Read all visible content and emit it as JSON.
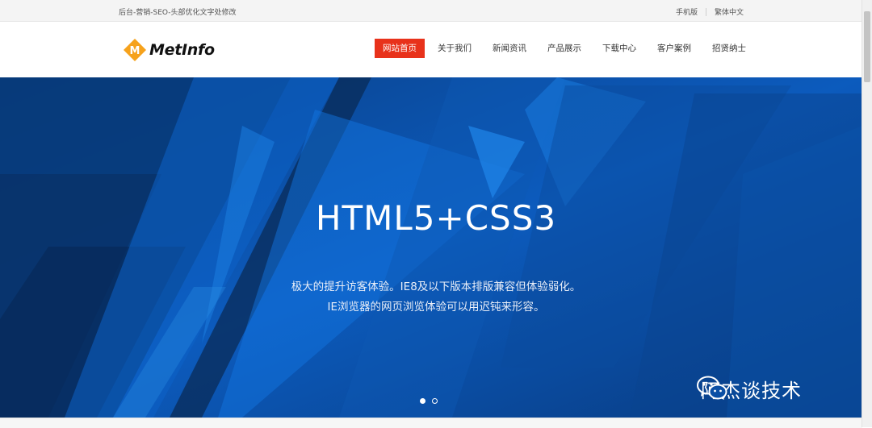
{
  "topbar": {
    "tagline": "后台-营销-SEO-头部优化文字处修改",
    "links": [
      "手机版",
      "繁体中文"
    ]
  },
  "logo": {
    "text": "MetInfo",
    "mark_letter": "M",
    "mark_color": "#f6a21c"
  },
  "nav": {
    "items": [
      "网站首页",
      "关于我们",
      "新闻资讯",
      "产品展示",
      "下载中心",
      "客户案例",
      "招贤纳士"
    ],
    "active_index": 0,
    "active_color": "#e8321b"
  },
  "hero": {
    "title": "HTML5+CSS3",
    "subtitle_line1": "极大的提升访客体验。IE8及以下版本排版兼容但体验弱化。",
    "subtitle_line2": "IE浏览器的网页浏览体验可以用迟钝来形容。",
    "slides": 2,
    "active_slide": 0,
    "bg_color": "#0b4fa5"
  },
  "watermark": {
    "icon": "wechat-icon",
    "text": "阿杰谈技术"
  }
}
